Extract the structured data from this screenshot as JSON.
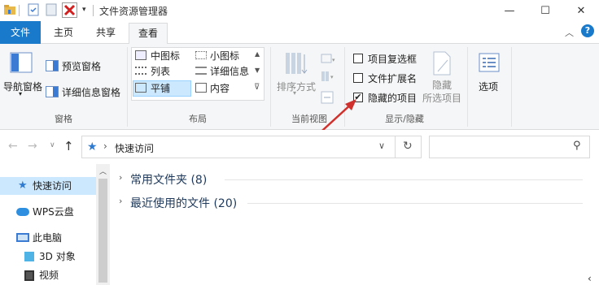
{
  "window": {
    "title": "文件资源管理器",
    "controls": {
      "minimize": "—",
      "maximize": "☐",
      "close": "✕"
    }
  },
  "tabs": [
    {
      "label": "文件"
    },
    {
      "label": "主页"
    },
    {
      "label": "共享"
    },
    {
      "label": "查看"
    }
  ],
  "ribbon": {
    "panes": {
      "nav_pane": "导航窗格",
      "preview_pane": "预览窗格",
      "details_pane": "详细信息窗格",
      "group": "窗格"
    },
    "layout": {
      "items": [
        "中图标",
        "小图标",
        "列表",
        "详细信息",
        "平铺",
        "内容"
      ],
      "selected": "平铺",
      "group": "布局"
    },
    "current_view": {
      "sort_by": "排序方式",
      "group": "当前视图"
    },
    "show_hide": {
      "item_checkboxes": {
        "label": "项目复选框",
        "checked": false
      },
      "file_extensions": {
        "label": "文件扩展名",
        "checked": false
      },
      "hidden_items": {
        "label": "隐藏的项目",
        "checked": true
      },
      "hide_selected": "隐藏\n所选项目",
      "hide_selected_line1": "隐藏",
      "hide_selected_line2": "所选项目",
      "group": "显示/隐藏"
    },
    "options": "选项"
  },
  "address": {
    "path": "快速访问",
    "separator": "›"
  },
  "nav_pane": {
    "items": [
      {
        "label": "快速访问",
        "selected": true
      },
      {
        "label": "WPS云盘"
      },
      {
        "label": "此电脑"
      },
      {
        "label": "3D 对象"
      },
      {
        "label": "视频"
      }
    ]
  },
  "content": {
    "groups": [
      {
        "label": "常用文件夹 (8)"
      },
      {
        "label": "最近使用的文件 (20)"
      }
    ]
  },
  "colors": {
    "file_tab": "#1979ca",
    "ribbon_bg": "#f5f6f7",
    "group_header": "#1e395b",
    "selection": "#cce8ff",
    "annotation_arrow": "#d0312d"
  }
}
